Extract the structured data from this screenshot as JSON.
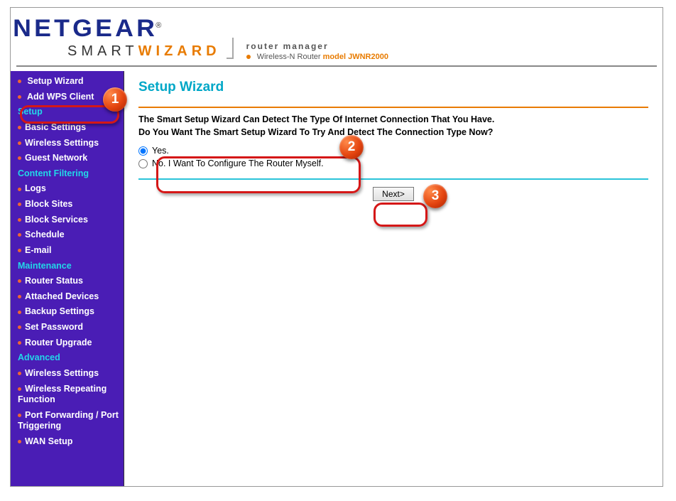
{
  "brand": {
    "name": "NETGEAR",
    "subbrand_a": "SMART",
    "subbrand_b": "WIZARD",
    "tagline": "router manager",
    "product_line": "Wireless-N Router",
    "model_prefix": "model",
    "model": "JWNR2000"
  },
  "sidebar": {
    "top": [
      {
        "label": "Setup Wizard"
      },
      {
        "label": "Add WPS Client"
      }
    ],
    "groups": [
      {
        "title": "Setup",
        "items": [
          {
            "label": "Basic Settings"
          },
          {
            "label": "Wireless Settings"
          },
          {
            "label": "Guest Network"
          }
        ]
      },
      {
        "title": "Content Filtering",
        "items": [
          {
            "label": "Logs"
          },
          {
            "label": "Block Sites"
          },
          {
            "label": "Block Services"
          },
          {
            "label": "Schedule"
          },
          {
            "label": "E-mail"
          }
        ]
      },
      {
        "title": "Maintenance",
        "items": [
          {
            "label": "Router Status"
          },
          {
            "label": "Attached Devices"
          },
          {
            "label": "Backup Settings"
          },
          {
            "label": "Set Password"
          },
          {
            "label": "Router Upgrade"
          }
        ]
      },
      {
        "title": "Advanced",
        "items": [
          {
            "label": "Wireless Settings"
          },
          {
            "label": "Wireless Repeating Function"
          },
          {
            "label": "Port Forwarding / Port Triggering"
          },
          {
            "label": "WAN Setup"
          }
        ]
      }
    ]
  },
  "content": {
    "title": "Setup Wizard",
    "desc_line1": "The Smart Setup Wizard Can Detect The Type Of Internet Connection That You Have.",
    "desc_line2": "Do You Want The Smart Setup Wizard To Try And Detect The Connection Type Now?",
    "options": {
      "yes": "Yes.",
      "no": "No. I Want To Configure The Router Myself.",
      "selected": "yes"
    },
    "next_btn": "Next>"
  },
  "callouts": {
    "b1": "1",
    "b2": "2",
    "b3": "3"
  }
}
